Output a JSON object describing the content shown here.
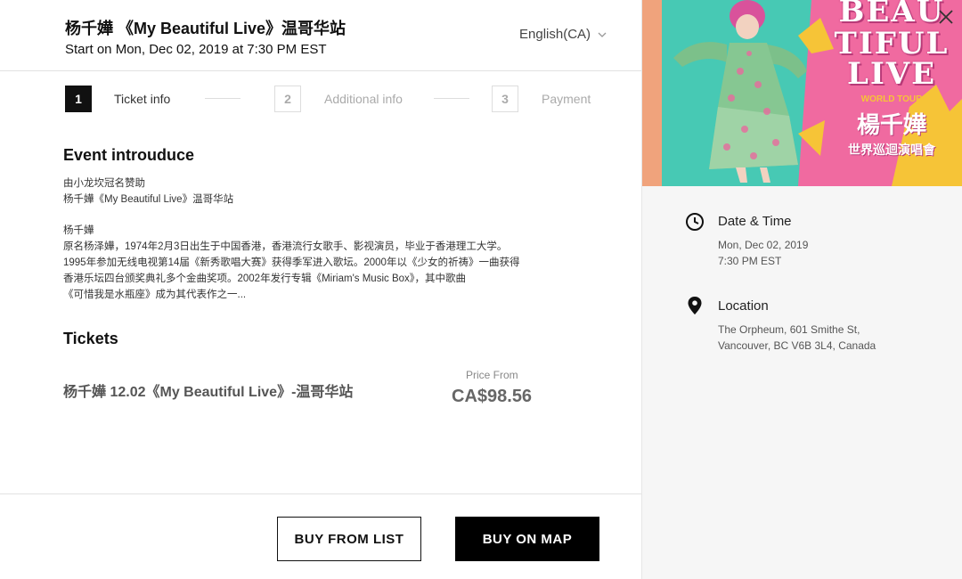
{
  "header": {
    "event_title": "杨千嬅 《My Beautiful Live》温哥华站",
    "start_text": "Start on Mon, Dec 02, 2019 at 7:30 PM EST",
    "language": "English(CA)"
  },
  "steps": [
    {
      "number": "1",
      "label": "Ticket info",
      "state": "active"
    },
    {
      "number": "2",
      "label": "Additional info",
      "state": "inactive"
    },
    {
      "number": "3",
      "label": "Payment",
      "state": "inactive"
    }
  ],
  "intro": {
    "heading": "Event introuduce",
    "lines_1": [
      "由小龙坎冠名赞助",
      "杨千嬅《My Beautiful Live》温哥华站"
    ],
    "lines_2": [
      "杨千嬅",
      "原名杨泽嬅，1974年2月3日出生于中国香港，香港流行女歌手、影视演员，毕业于香港理工大学。",
      "1995年参加无线电视第14届《新秀歌唱大赛》获得季军进入歌坛。2000年以《少女的祈祷》一曲获得",
      "香港乐坛四台颁奖典礼多个金曲奖项。2002年发行专辑《Miriam's Music Box》，其中歌曲",
      "《可惜我是水瓶座》成为其代表作之一..."
    ]
  },
  "tickets": {
    "heading": "Tickets",
    "name": "杨千嬅 12.02《My Beautiful Live》-温哥华站",
    "price_from_label": "Price From",
    "price": "CA$98.56"
  },
  "footer": {
    "buy_from_list": "BUY FROM LIST",
    "buy_on_map": "BUY ON MAP"
  },
  "poster": {
    "words": [
      "BEAU",
      "TIFUL",
      "LIVE"
    ],
    "tour": "WORLD TOUR",
    "artist": "楊千嬅",
    "subtitle": "世界巡迴演唱會"
  },
  "details": {
    "date_title": "Date & Time",
    "date_line1": "Mon, Dec 02, 2019",
    "date_line2": "7:30 PM EST",
    "location_title": "Location",
    "location_line1": "The Orpheum, 601 Smithe St,",
    "location_line2": "Vancouver, BC V6B 3L4, Canada"
  },
  "icons": {
    "language_dropdown": "chevron-down-icon",
    "close": "close-icon",
    "date": "clock-icon",
    "location": "map-pin-icon"
  },
  "colors": {
    "primary_button": "#000000",
    "poster_pink": "#f06aa0",
    "poster_teal": "#47c9b4",
    "poster_yellow": "#f6c437"
  }
}
